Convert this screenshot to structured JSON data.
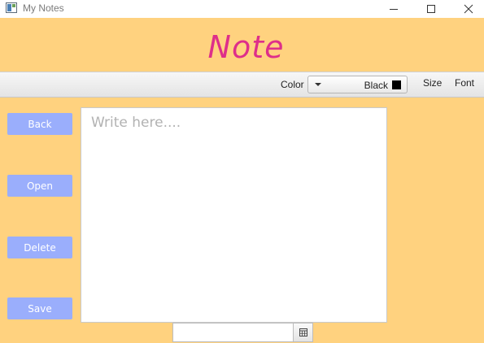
{
  "window": {
    "title": "My Notes",
    "icons": {
      "app": "notes-app-icon",
      "minimize": "minimize-icon",
      "maximize": "maximize-icon",
      "close": "close-icon"
    }
  },
  "header": {
    "title": "Note",
    "title_color": "#de2f8a"
  },
  "toolbar": {
    "color_label": "Color",
    "color_value": "Black",
    "color_swatch": "#000000",
    "size_label": "Size",
    "font_label": "Font"
  },
  "sidebar": {
    "button_color": "#9aaefc",
    "buttons": [
      {
        "label": "Back"
      },
      {
        "label": "Open"
      },
      {
        "label": "Delete"
      },
      {
        "label": "Save"
      }
    ]
  },
  "editor": {
    "value": "",
    "placeholder": "Write here...."
  },
  "date_picker": {
    "value": "",
    "icon": "calendar-icon"
  },
  "theme": {
    "background": "#ffd27f"
  }
}
